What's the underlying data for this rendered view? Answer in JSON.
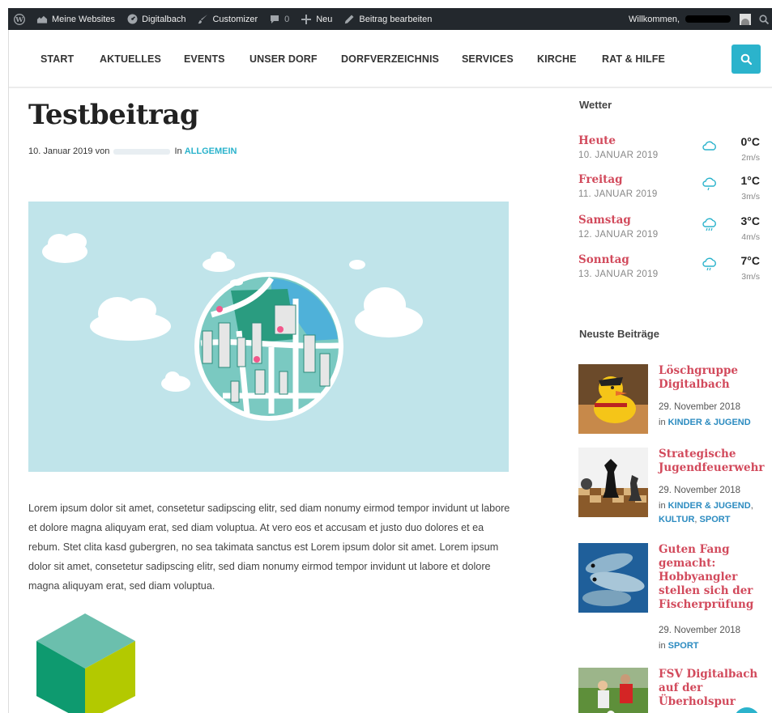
{
  "adminbar": {
    "my_sites": "Meine Websites",
    "site_name": "Digitalbach",
    "customizer": "Customizer",
    "comments_count": "0",
    "new": "Neu",
    "edit_post": "Beitrag bearbeiten",
    "welcome": "Willkommen,"
  },
  "nav": {
    "items": [
      "START",
      "AKTUELLES",
      "EVENTS",
      "UNSER DORF",
      "DORFVERZEICHNIS",
      "SERVICES",
      "KIRCHE",
      "RAT & HILFE"
    ]
  },
  "post": {
    "title": "Testbeitrag",
    "date": "10. Januar 2019",
    "by": "von",
    "in": "In",
    "category": "ALLGEMEIN",
    "body": "Lorem ipsum dolor sit amet, consetetur sadipscing elitr, sed diam nonumy eirmod tempor invidunt ut labore et dolore magna aliquyam erat, sed diam voluptua. At vero eos et accusam et justo duo dolores et ea rebum. Stet clita kasd gubergren, no sea takimata sanctus est Lorem ipsum dolor sit amet. Lorem ipsum dolor sit amet, consetetur sadipscing elitr, sed diam nonumy eirmod tempor invidunt ut labore et dolore magna aliquyam erat, sed diam voluptua."
  },
  "weather": {
    "title": "Wetter",
    "days": [
      {
        "day": "Heute",
        "date": "10. JANUAR 2019",
        "temp": "0°C",
        "wind": "2m/s",
        "icon": "cloud-icon"
      },
      {
        "day": "Freitag",
        "date": "11. JANUAR 2019",
        "temp": "1°C",
        "wind": "3m/s",
        "icon": "cloud-rain-icon"
      },
      {
        "day": "Samstag",
        "date": "12. JANUAR 2019",
        "temp": "3°C",
        "wind": "4m/s",
        "icon": "cloud-rain-icon"
      },
      {
        "day": "Sonntag",
        "date": "13. JANUAR 2019",
        "temp": "7°C",
        "wind": "3m/s",
        "icon": "cloud-rain-icon"
      }
    ]
  },
  "recent": {
    "title": "Neuste Beiträge",
    "posts": [
      {
        "title": "Löschgruppe Digitalbach",
        "date": "29. November 2018",
        "in": "in",
        "cats": [
          "KINDER & JUGEND"
        ]
      },
      {
        "title": "Strategische Jugendfeuerwehr",
        "date": "29. November 2018",
        "in": "in",
        "cats": [
          "KINDER & JUGEND",
          "KULTUR",
          "SPORT"
        ]
      },
      {
        "title": "Guten Fang gemacht: Hobbyangler stellen sich der Fischerprüfung",
        "date": "29. November 2018",
        "in": "in",
        "cats": [
          "SPORT"
        ]
      },
      {
        "title": "FSV Digitalbach auf der Überholspur",
        "date": "",
        "in": "",
        "cats": []
      }
    ]
  },
  "colors": {
    "accent": "#2bb3cc",
    "title_red": "#d24a5c",
    "category_blue": "#2b8bc0",
    "adminbar_bg": "#23282d"
  }
}
